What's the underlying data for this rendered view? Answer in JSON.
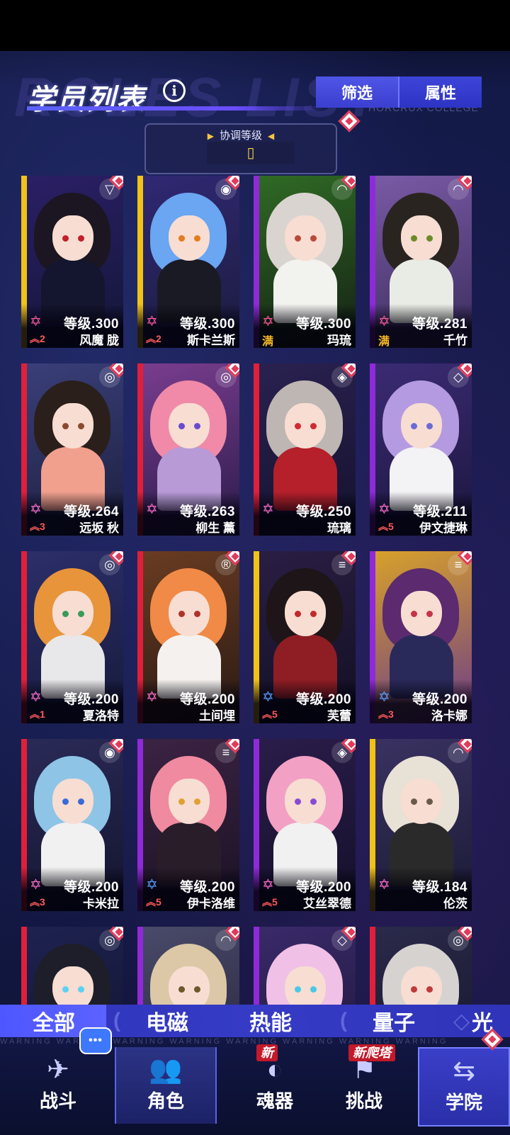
{
  "header": {
    "title": "学员列表",
    "bg_text": "ROLES LIST",
    "subtitle_en": "HORCRUX COLLEGE",
    "filter_label": "筛选",
    "attribute_label": "属性"
  },
  "sort": {
    "label": "协调等级",
    "value": "▯"
  },
  "characters": [
    {
      "name": "风魔 胧",
      "level": "等级.300",
      "rank": "2",
      "element": "▽",
      "stripe": "#f1c316",
      "hair": "#1b1621",
      "body": "#14152e",
      "eye": "#c01f2c",
      "bg1": "#2b1f66",
      "bg2": "#131638",
      "star": "#ff5a9a"
    },
    {
      "name": "斯卡兰斯",
      "level": "等级.300",
      "rank": "2",
      "element": "◉",
      "stripe": "#f1c316",
      "hair": "#6aa6f2",
      "body": "#1a1a24",
      "eye": "#e47b1c",
      "bg1": "#312874",
      "bg2": "#1b1c3d",
      "star": "#ff5a9a"
    },
    {
      "name": "玛琉",
      "level": "等级.300",
      "rank": "满",
      "element": "◠",
      "stripe": "#8f2ad8",
      "hair": "#d9d4cf",
      "body": "#f2f2ef",
      "eye": "#b94a3a",
      "bg1": "#2f6b25",
      "bg2": "#152014",
      "star": "#ff5a9a"
    },
    {
      "name": "千竹",
      "level": "等级.281",
      "rank": "满",
      "element": "◠",
      "stripe": "#8f2ad8",
      "hair": "#2a2420",
      "body": "#e9ece5",
      "eye": "#6b8a2a",
      "bg1": "#7a5aa6",
      "bg2": "#3a2d5d",
      "star": "#ff5a9a"
    },
    {
      "name": "远坂 秋",
      "level": "等级.264",
      "rank": "3",
      "element": "◎",
      "stripe": "#e0203a",
      "hair": "#2a1f1b",
      "body": "#f1a08d",
      "eye": "#8a4a2f",
      "bg1": "#3a3f7a",
      "bg2": "#1c1f3e",
      "star": "#ff6fd0"
    },
    {
      "name": "柳生 薰",
      "level": "等级.263",
      "rank": "",
      "element": "◎",
      "stripe": "#e0203a",
      "hair": "#f08aa8",
      "body": "#b79ad6",
      "eye": "#6a4ad0",
      "bg1": "#7a3d8f",
      "bg2": "#2a1b4a",
      "star": "#ff6fd0"
    },
    {
      "name": "琉璃",
      "level": "等级.250",
      "rank": "",
      "element": "◈",
      "stripe": "#e0203a",
      "hair": "#bdb6b3",
      "body": "#b5202b",
      "eye": "#d22a33",
      "bg1": "#2a2150",
      "bg2": "#15122e",
      "star": "#ff6fd0"
    },
    {
      "name": "伊文捷琳",
      "level": "等级.211",
      "rank": "5",
      "element": "◇",
      "stripe": "#8f2ad8",
      "hair": "#b49ae0",
      "body": "#f3f2f5",
      "eye": "#6a6ad8",
      "bg1": "#3b2b74",
      "bg2": "#1c163e",
      "star": "#ff6fd0"
    },
    {
      "name": "夏洛特",
      "level": "等级.200",
      "rank": "1",
      "element": "◎",
      "stripe": "#e0203a",
      "hair": "#e8943a",
      "body": "#e8e8ea",
      "eye": "#3a9a5a",
      "bg1": "#2c2f6a",
      "bg2": "#161a3a",
      "star": "#ff6fd0"
    },
    {
      "name": "土间埋",
      "level": "等级.200",
      "rank": "",
      "element": "®",
      "stripe": "#e0203a",
      "hair": "#f08a46",
      "body": "#f4f1ee",
      "eye": "#b0342a",
      "bg1": "#6a3c22",
      "bg2": "#2a1a14",
      "star": "#ff6fd0"
    },
    {
      "name": "芙蕾",
      "level": "等级.200",
      "rank": "5",
      "element": "≡",
      "stripe": "#f1c316",
      "hair": "#1d1517",
      "body": "#8e1e24",
      "eye": "#c32a2a",
      "bg1": "#2a1e44",
      "bg2": "#120f22",
      "star": "#5aa0ff"
    },
    {
      "name": "洛卡娜",
      "level": "等级.200",
      "rank": "3",
      "element": "≡",
      "stripe": "#8f2ad8",
      "hair": "#5c2a6e",
      "body": "#2a2a5a",
      "eye": "#c8324a",
      "bg1": "#d8a12a",
      "bg2": "#6b3b8a",
      "star": "#5aa0ff"
    },
    {
      "name": "卡米拉",
      "level": "等级.200",
      "rank": "3",
      "element": "◉",
      "stripe": "#e0203a",
      "hair": "#8ec4e6",
      "body": "#f1f1f1",
      "eye": "#3a6ad8",
      "bg1": "#2a2a58",
      "bg2": "#14142e",
      "star": "#ff6fd0"
    },
    {
      "name": "伊卡洛维",
      "level": "等级.200",
      "rank": "5",
      "element": "≡",
      "stripe": "#8f2ad8",
      "hair": "#f08aa0",
      "body": "#2a1d2a",
      "eye": "#e1a030",
      "bg1": "#3c2344",
      "bg2": "#1a1224",
      "star": "#5aa0ff"
    },
    {
      "name": "艾丝翠德",
      "level": "等级.200",
      "rank": "5",
      "element": "◈",
      "stripe": "#8f2ad8",
      "hair": "#f2a0c4",
      "body": "#f1f1f1",
      "eye": "#8a4ad8",
      "bg1": "#2a1d4a",
      "bg2": "#14102a",
      "star": "#ff6fd0"
    },
    {
      "name": "伦茨",
      "level": "等级.184",
      "rank": "",
      "element": "◠",
      "stripe": "#f1c316",
      "hair": "#e8e1d6",
      "body": "#2a2a2a",
      "eye": "#6a5a4a",
      "bg1": "#3a3262",
      "bg2": "#1a1a34",
      "star": "#ff6fd0"
    },
    {
      "name": "",
      "level": "",
      "rank": "",
      "element": "◎",
      "stripe": "#e0203a",
      "hair": "#1e1e2a",
      "body": "#22223a",
      "eye": "#5ad2f0",
      "bg1": "#1e2250",
      "bg2": "#10122a",
      "star": "#ff6fd0"
    },
    {
      "name": "",
      "level": "",
      "rank": "",
      "element": "◠",
      "stripe": "#8f2ad8",
      "hair": "#dcc8a6",
      "body": "#f2ede2",
      "eye": "#6a5a2a",
      "bg1": "#4a4a6a",
      "bg2": "#22223a",
      "star": "#ff6fd0"
    },
    {
      "name": "",
      "level": "",
      "rank": "",
      "element": "◇",
      "stripe": "#8f2ad8",
      "hair": "#f0c0e6",
      "body": "#e6d6f2",
      "eye": "#4ac8e6",
      "bg1": "#3a2a6a",
      "bg2": "#1a1434",
      "star": "#ff6fd0"
    },
    {
      "name": "",
      "level": "",
      "rank": "",
      "element": "◎",
      "stripe": "#e0203a",
      "hair": "#d6d2d0",
      "body": "#2a2a3a",
      "eye": "#c03a3a",
      "bg1": "#2a2a4a",
      "bg2": "#14142a",
      "star": "#ff6fd0"
    }
  ],
  "categories": [
    {
      "label": "全部"
    },
    {
      "label": "电磁"
    },
    {
      "label": "热能"
    },
    {
      "label": "量子"
    },
    {
      "label": "光"
    }
  ],
  "nav": {
    "battle": "战斗",
    "role": "角色",
    "soul": "魂器",
    "challenge": "挑战",
    "academy": "学院",
    "soul_badge": "新",
    "challenge_badge": "新爬塔",
    "chat_label": "•••",
    "warning_text": "WARNING  WARNING  WARNING  WARNING  WARNING  WARNING  WARNING  WARNING"
  },
  "colors": {
    "accent": "#4f55e6",
    "badge_red": "#c21a2a",
    "gold": "#f1c316"
  }
}
